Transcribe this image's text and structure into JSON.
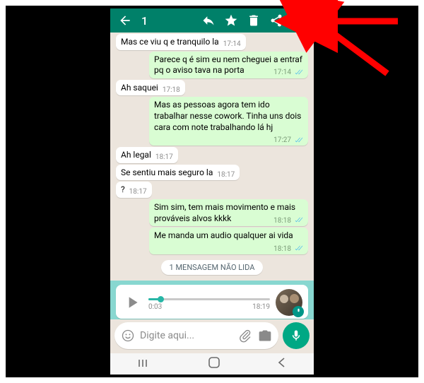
{
  "colors": {
    "header": "#008069",
    "accent": "#00a884",
    "selection": "#88d7d0"
  },
  "action_bar": {
    "selected_count": "1"
  },
  "messages": [
    {
      "dir": "in",
      "text": "Mas ce viu q e tranquilo la",
      "time": "17:14",
      "ticks": false
    },
    {
      "dir": "out",
      "text": "Parece q é sim eu nem cheguei a entraf pq o aviso tava na porta",
      "time": "17:14",
      "ticks": true
    },
    {
      "dir": "in",
      "text": "Ah saquei",
      "time": "17:18",
      "ticks": false
    },
    {
      "dir": "out",
      "text": "Mas as pessoas agora tem ido trabalhar nesse cowork. Tinha uns dois cara com note trabalhando  lá hj",
      "time": "17:27",
      "ticks": true
    },
    {
      "dir": "in",
      "text": "Ah legal",
      "time": "18:17",
      "ticks": false
    },
    {
      "dir": "in",
      "text": "Se sentiu mais seguro la",
      "time": "18:17",
      "ticks": false
    },
    {
      "dir": "in",
      "text": "?",
      "time": "18:17",
      "ticks": false
    },
    {
      "dir": "out",
      "text": "Sim sim, tem mais movimento e mais prováveis alvos kkkk",
      "time": "18:18",
      "ticks": true
    },
    {
      "dir": "out",
      "text": "Me manda um audio qualquer ai vida",
      "time": "18:18",
      "ticks": true
    }
  ],
  "unread_label": "1 MENSAGEM NÃO LIDA",
  "voice": {
    "duration": "0:03",
    "time": "18:19",
    "progress_pct": 10
  },
  "composer": {
    "placeholder": "Digite aqui..."
  }
}
